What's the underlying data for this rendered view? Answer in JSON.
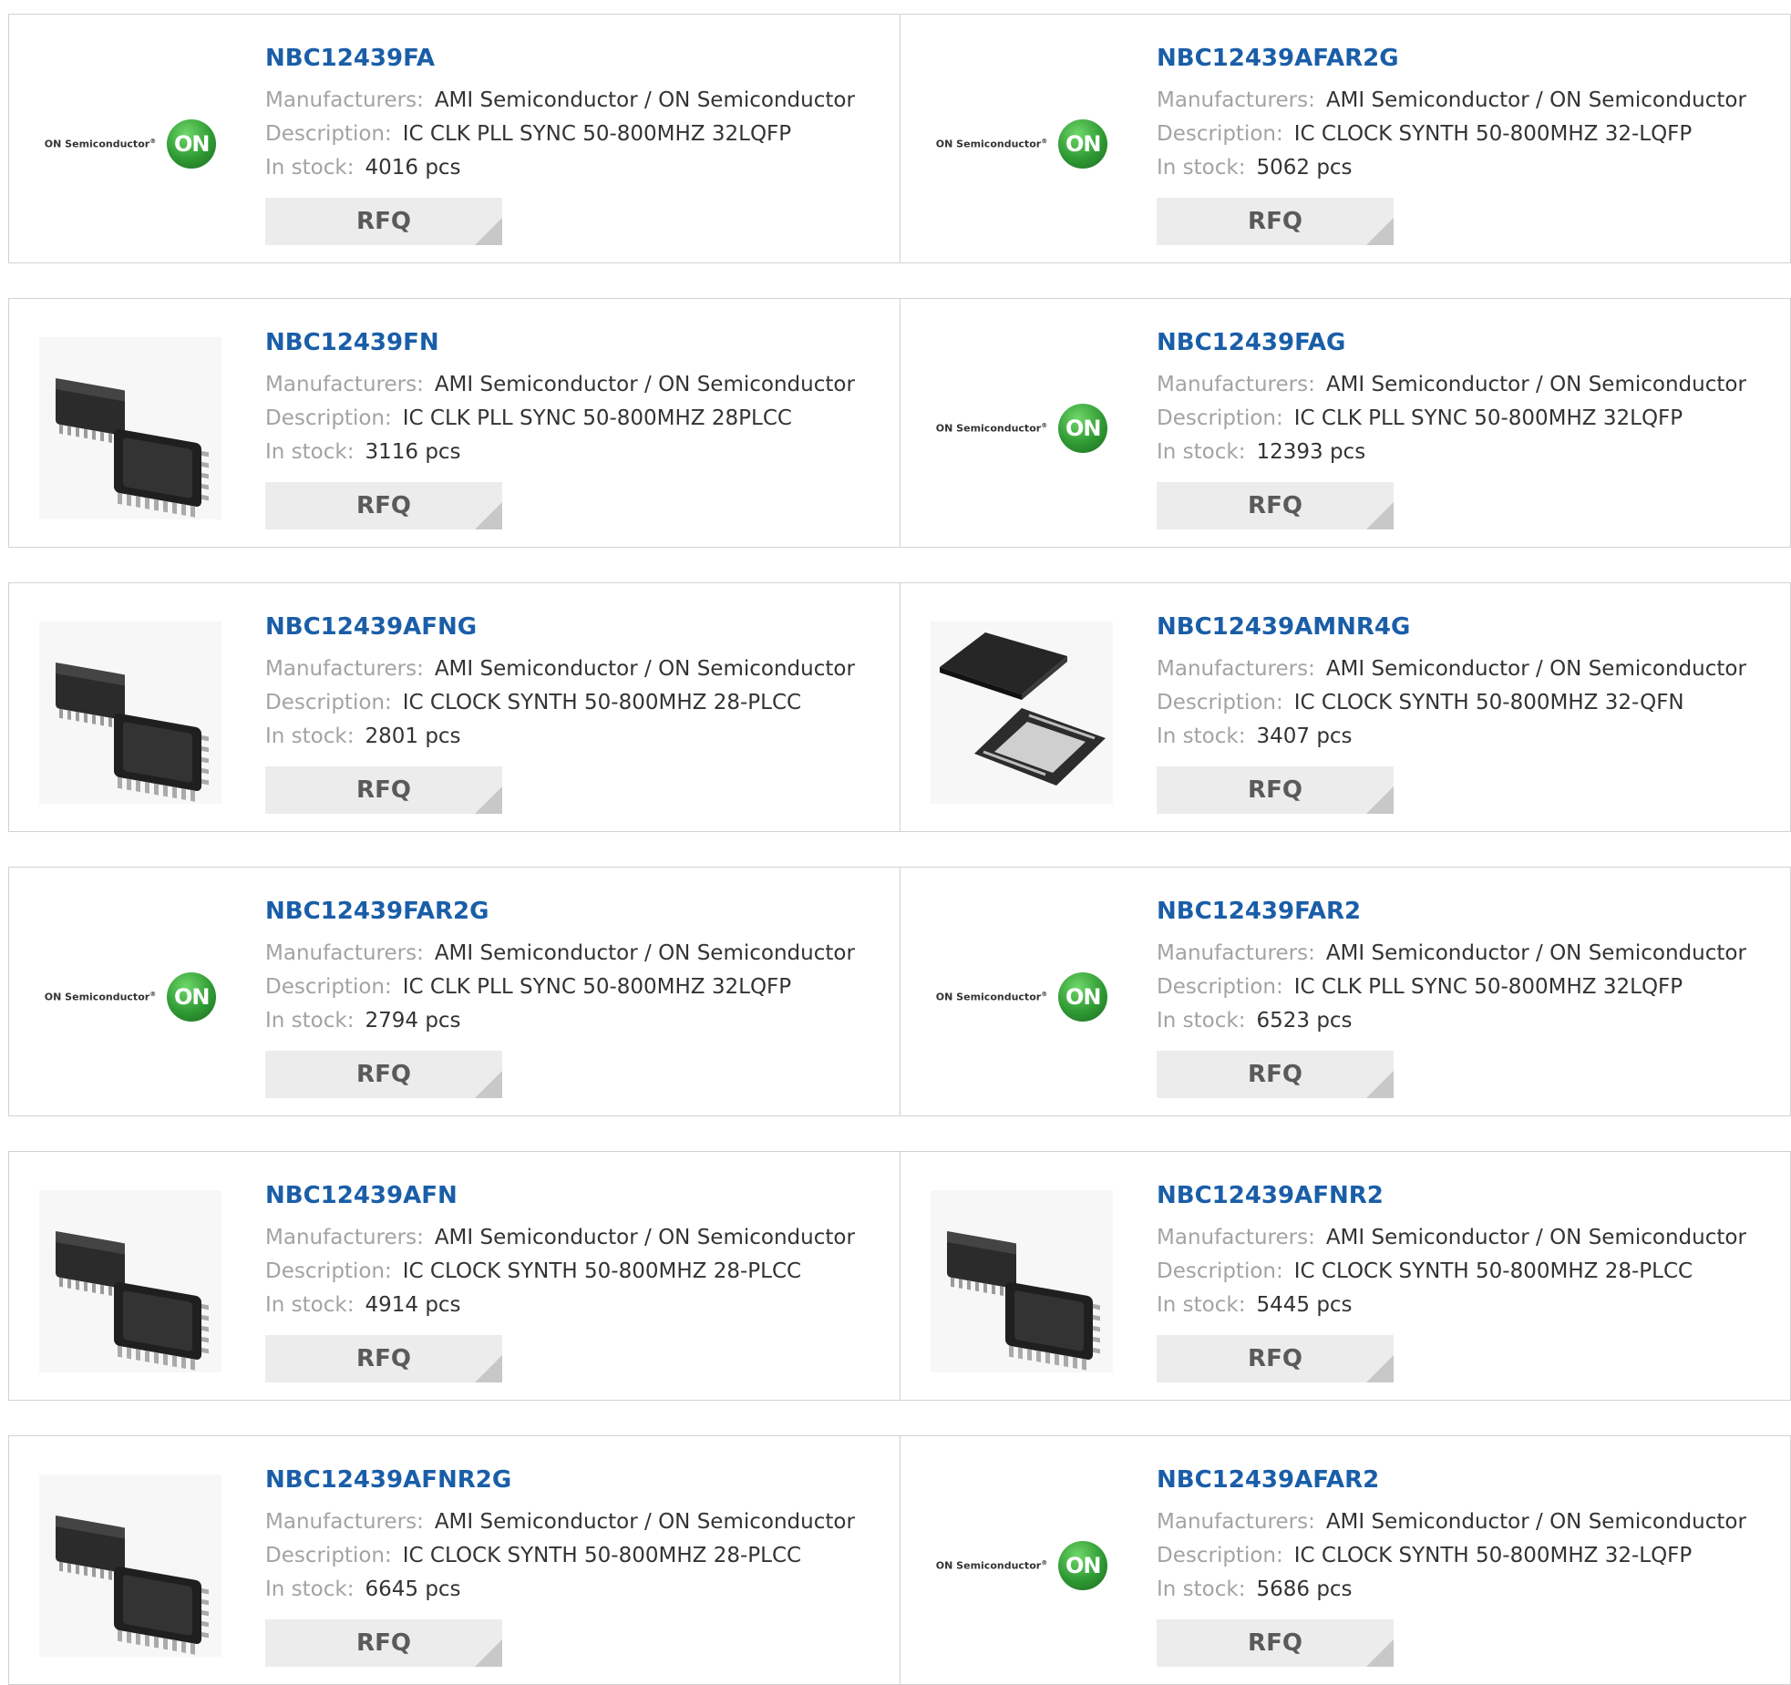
{
  "labels": {
    "manufacturers": "Manufacturers:",
    "description": "Description:",
    "in_stock": "In stock:"
  },
  "logo_text": {
    "wordmark": "ON Semiconductor",
    "reg": "®",
    "badge": "ON"
  },
  "colors": {
    "part_link": "#1a5ea8",
    "label": "#a3a3a3",
    "value": "#333333",
    "rfq_bg": "#ececec",
    "on_green": "#2f9a33"
  },
  "products": [
    {
      "part": "NBC12439FA",
      "manufacturer": "AMI Semiconductor / ON Semiconductor",
      "description": "IC CLK PLL SYNC 50-800MHZ 32LQFP",
      "stock": "4016 pcs",
      "image": "on-semiconductor-logo",
      "rfq": "RFQ"
    },
    {
      "part": "NBC12439AFAR2G",
      "manufacturer": "AMI Semiconductor / ON Semiconductor",
      "description": "IC CLOCK SYNTH 50-800MHZ 32-LQFP",
      "stock": "5062 pcs",
      "image": "on-semiconductor-logo",
      "rfq": "RFQ"
    },
    {
      "part": "NBC12439FN",
      "manufacturer": "AMI Semiconductor / ON Semiconductor",
      "description": "IC CLK PLL SYNC 50-800MHZ 28PLCC",
      "stock": "3116 pcs",
      "image": "plcc-chip-photo",
      "rfq": "RFQ"
    },
    {
      "part": "NBC12439FAG",
      "manufacturer": "AMI Semiconductor / ON Semiconductor",
      "description": "IC CLK PLL SYNC 50-800MHZ 32LQFP",
      "stock": "12393 pcs",
      "image": "on-semiconductor-logo",
      "rfq": "RFQ"
    },
    {
      "part": "NBC12439AFNG",
      "manufacturer": "AMI Semiconductor / ON Semiconductor",
      "description": "IC CLOCK SYNTH 50-800MHZ 28-PLCC",
      "stock": "2801 pcs",
      "image": "plcc-chip-photo",
      "rfq": "RFQ"
    },
    {
      "part": "NBC12439AMNR4G",
      "manufacturer": "AMI Semiconductor / ON Semiconductor",
      "description": "IC CLOCK SYNTH 50-800MHZ 32-QFN",
      "stock": "3407 pcs",
      "image": "qfn-chip-photo",
      "rfq": "RFQ"
    },
    {
      "part": "NBC12439FAR2G",
      "manufacturer": "AMI Semiconductor / ON Semiconductor",
      "description": "IC CLK PLL SYNC 50-800MHZ 32LQFP",
      "stock": "2794 pcs",
      "image": "on-semiconductor-logo",
      "rfq": "RFQ"
    },
    {
      "part": "NBC12439FAR2",
      "manufacturer": "AMI Semiconductor / ON Semiconductor",
      "description": "IC CLK PLL SYNC 50-800MHZ 32LQFP",
      "stock": "6523 pcs",
      "image": "on-semiconductor-logo",
      "rfq": "RFQ"
    },
    {
      "part": "NBC12439AFN",
      "manufacturer": "AMI Semiconductor / ON Semiconductor",
      "description": "IC CLOCK SYNTH 50-800MHZ 28-PLCC",
      "stock": "4914 pcs",
      "image": "plcc-chip-photo",
      "rfq": "RFQ"
    },
    {
      "part": "NBC12439AFNR2",
      "manufacturer": "AMI Semiconductor / ON Semiconductor",
      "description": "IC CLOCK SYNTH 50-800MHZ 28-PLCC",
      "stock": "5445 pcs",
      "image": "plcc-chip-photo",
      "rfq": "RFQ"
    },
    {
      "part": "NBC12439AFNR2G",
      "manufacturer": "AMI Semiconductor / ON Semiconductor",
      "description": "IC CLOCK SYNTH 50-800MHZ 28-PLCC",
      "stock": "6645 pcs",
      "image": "plcc-chip-photo",
      "rfq": "RFQ"
    },
    {
      "part": "NBC12439AFAR2",
      "manufacturer": "AMI Semiconductor / ON Semiconductor",
      "description": "IC CLOCK SYNTH 50-800MHZ 32-LQFP",
      "stock": "5686 pcs",
      "image": "on-semiconductor-logo",
      "rfq": "RFQ"
    }
  ]
}
